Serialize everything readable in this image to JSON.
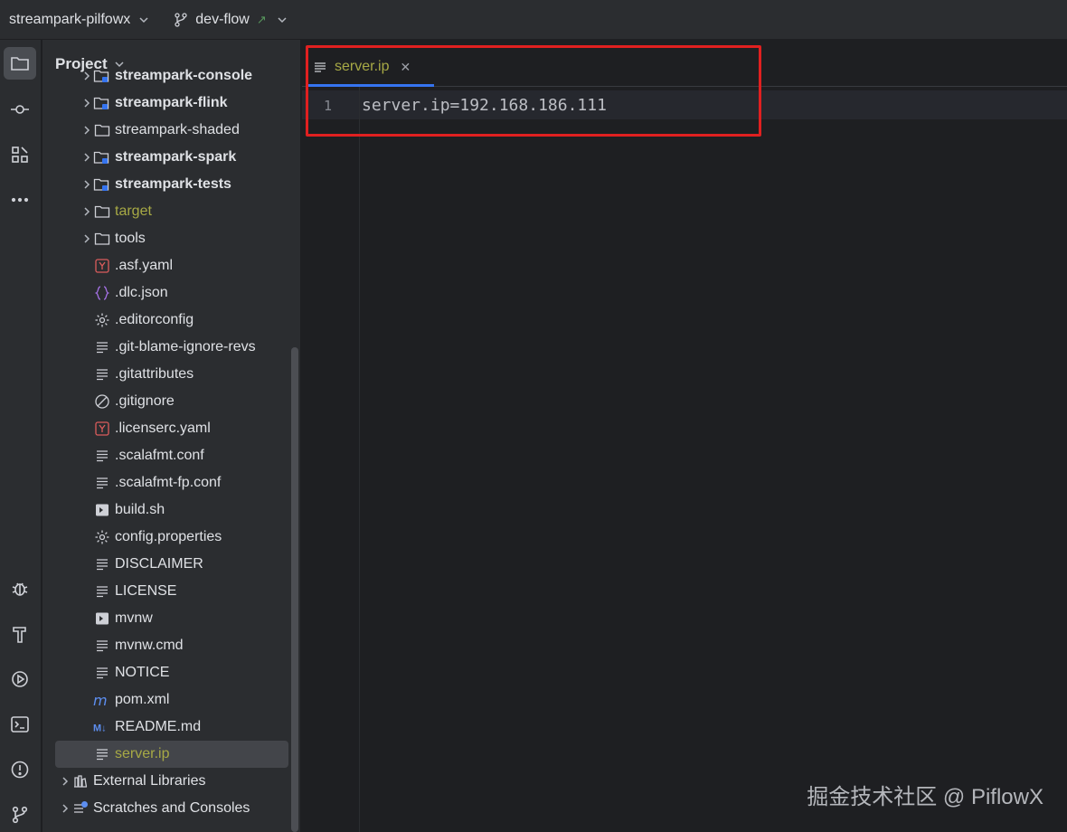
{
  "titlebar": {
    "project_name": "streampark-pilfowx",
    "branch_name": "dev-flow"
  },
  "panel": {
    "title": "Project"
  },
  "tree": [
    {
      "label": "streampark-console",
      "type": "module",
      "expandable": true,
      "style": "bold"
    },
    {
      "label": "streampark-flink",
      "type": "module",
      "expandable": true,
      "style": "bold"
    },
    {
      "label": "streampark-shaded",
      "type": "folder",
      "expandable": true,
      "style": "normal"
    },
    {
      "label": "streampark-spark",
      "type": "module",
      "expandable": true,
      "style": "bold"
    },
    {
      "label": "streampark-tests",
      "type": "module",
      "expandable": true,
      "style": "bold"
    },
    {
      "label": "target",
      "type": "folder",
      "expandable": true,
      "style": "olive"
    },
    {
      "label": "tools",
      "type": "folder",
      "expandable": true,
      "style": "normal"
    },
    {
      "label": ".asf.yaml",
      "type": "yaml",
      "expandable": false,
      "style": "normal"
    },
    {
      "label": ".dlc.json",
      "type": "json",
      "expandable": false,
      "style": "normal"
    },
    {
      "label": ".editorconfig",
      "type": "gear",
      "expandable": false,
      "style": "normal"
    },
    {
      "label": ".git-blame-ignore-revs",
      "type": "text",
      "expandable": false,
      "style": "normal"
    },
    {
      "label": ".gitattributes",
      "type": "text",
      "expandable": false,
      "style": "normal"
    },
    {
      "label": ".gitignore",
      "type": "ignore",
      "expandable": false,
      "style": "normal"
    },
    {
      "label": ".licenserc.yaml",
      "type": "yaml",
      "expandable": false,
      "style": "normal"
    },
    {
      "label": ".scalafmt.conf",
      "type": "text",
      "expandable": false,
      "style": "normal"
    },
    {
      "label": ".scalafmt-fp.conf",
      "type": "text",
      "expandable": false,
      "style": "normal"
    },
    {
      "label": "build.sh",
      "type": "shell",
      "expandable": false,
      "style": "normal"
    },
    {
      "label": "config.properties",
      "type": "gear",
      "expandable": false,
      "style": "normal"
    },
    {
      "label": "DISCLAIMER",
      "type": "text",
      "expandable": false,
      "style": "normal"
    },
    {
      "label": "LICENSE",
      "type": "text",
      "expandable": false,
      "style": "normal"
    },
    {
      "label": "mvnw",
      "type": "shell",
      "expandable": false,
      "style": "normal"
    },
    {
      "label": "mvnw.cmd",
      "type": "text",
      "expandable": false,
      "style": "normal"
    },
    {
      "label": "NOTICE",
      "type": "text",
      "expandable": false,
      "style": "normal"
    },
    {
      "label": "pom.xml",
      "type": "maven",
      "expandable": false,
      "style": "normal"
    },
    {
      "label": "README.md",
      "type": "markdown",
      "expandable": false,
      "style": "normal"
    },
    {
      "label": "server.ip",
      "type": "text",
      "expandable": false,
      "style": "olive",
      "selected": true
    },
    {
      "label": "External Libraries",
      "type": "libraries",
      "expandable": true,
      "style": "normal",
      "outdent": true
    },
    {
      "label": "Scratches and Consoles",
      "type": "scratches",
      "expandable": true,
      "style": "normal",
      "outdent": true
    }
  ],
  "editor": {
    "tab_label": "server.ip",
    "line_number": "1",
    "code_line": "server.ip=192.168.186.111"
  },
  "stripe_icons": [
    "folder-icon",
    "commit-icon",
    "structure-icon",
    "more-icon",
    "debug-icon",
    "build-icon",
    "run-icon",
    "terminal-icon",
    "problems-icon",
    "git-icon"
  ],
  "watermark": "掘金技术社区 @ PiflowX",
  "colors": {
    "accent": "#3574f0",
    "highlight_box": "#e02020",
    "modified_file": "#a7a945"
  }
}
